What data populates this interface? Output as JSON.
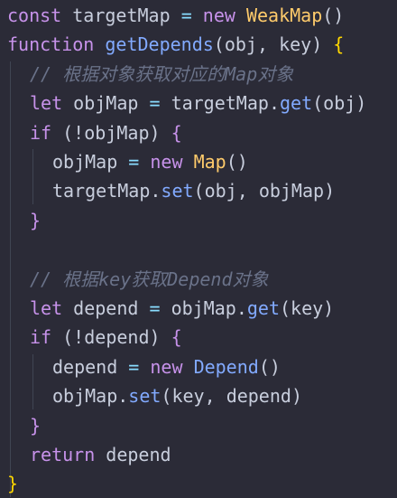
{
  "theme": {
    "background": "#2b2b37",
    "keyword": "#c792ea",
    "function": "#82aaff",
    "variable": "#c8cedd",
    "operator": "#89ddff",
    "class": "#ffcb6b",
    "comment": "#6a7289",
    "punctuation": "#c8cedd",
    "brace": "#ffd700",
    "indent_guide": "#404553"
  },
  "code": {
    "lines": [
      {
        "indent": 0,
        "tokens": [
          {
            "t": "const",
            "k": "keyword"
          },
          {
            "t": " "
          },
          {
            "t": "targetMap",
            "k": "variable"
          },
          {
            "t": " "
          },
          {
            "t": "=",
            "k": "operator"
          },
          {
            "t": " "
          },
          {
            "t": "new",
            "k": "keyword"
          },
          {
            "t": " "
          },
          {
            "t": "WeakMap",
            "k": "class"
          },
          {
            "t": "()",
            "k": "punctuation"
          }
        ]
      },
      {
        "indent": 0,
        "tokens": [
          {
            "t": "function",
            "k": "keyword"
          },
          {
            "t": " "
          },
          {
            "t": "getDepends",
            "k": "function"
          },
          {
            "t": "(",
            "k": "punctuation"
          },
          {
            "t": "obj",
            "k": "variable"
          },
          {
            "t": ", ",
            "k": "punctuation"
          },
          {
            "t": "key",
            "k": "variable"
          },
          {
            "t": ") ",
            "k": "punctuation"
          },
          {
            "t": "{",
            "k": "brace"
          }
        ]
      },
      {
        "indent": 1,
        "tokens": [
          {
            "t": "// 根据对象获取对应的Map对象",
            "k": "comment"
          }
        ]
      },
      {
        "indent": 1,
        "tokens": [
          {
            "t": "let",
            "k": "keyword"
          },
          {
            "t": " "
          },
          {
            "t": "objMap",
            "k": "variable"
          },
          {
            "t": " "
          },
          {
            "t": "=",
            "k": "operator"
          },
          {
            "t": " "
          },
          {
            "t": "targetMap",
            "k": "variable"
          },
          {
            "t": ".",
            "k": "punctuation"
          },
          {
            "t": "get",
            "k": "function"
          },
          {
            "t": "(",
            "k": "punctuation"
          },
          {
            "t": "obj",
            "k": "variable"
          },
          {
            "t": ")",
            "k": "punctuation"
          }
        ]
      },
      {
        "indent": 1,
        "tokens": [
          {
            "t": "if",
            "k": "keyword"
          },
          {
            "t": " "
          },
          {
            "t": "(!",
            "k": "punctuation"
          },
          {
            "t": "objMap",
            "k": "variable"
          },
          {
            "t": ") ",
            "k": "punctuation"
          },
          {
            "t": "{",
            "k": "keyword"
          }
        ]
      },
      {
        "indent": 2,
        "tokens": [
          {
            "t": "objMap",
            "k": "variable"
          },
          {
            "t": " "
          },
          {
            "t": "=",
            "k": "operator"
          },
          {
            "t": " "
          },
          {
            "t": "new",
            "k": "keyword"
          },
          {
            "t": " "
          },
          {
            "t": "Map",
            "k": "class"
          },
          {
            "t": "()",
            "k": "punctuation"
          }
        ]
      },
      {
        "indent": 2,
        "tokens": [
          {
            "t": "targetMap",
            "k": "variable"
          },
          {
            "t": ".",
            "k": "punctuation"
          },
          {
            "t": "set",
            "k": "function"
          },
          {
            "t": "(",
            "k": "punctuation"
          },
          {
            "t": "obj",
            "k": "variable"
          },
          {
            "t": ", ",
            "k": "punctuation"
          },
          {
            "t": "objMap",
            "k": "variable"
          },
          {
            "t": ")",
            "k": "punctuation"
          }
        ]
      },
      {
        "indent": 1,
        "tokens": [
          {
            "t": "}",
            "k": "keyword"
          }
        ]
      },
      {
        "indent": 0,
        "tokens": []
      },
      {
        "indent": 1,
        "tokens": [
          {
            "t": "// 根据key获取Depend对象",
            "k": "comment"
          }
        ]
      },
      {
        "indent": 1,
        "tokens": [
          {
            "t": "let",
            "k": "keyword"
          },
          {
            "t": " "
          },
          {
            "t": "depend",
            "k": "variable"
          },
          {
            "t": " "
          },
          {
            "t": "=",
            "k": "operator"
          },
          {
            "t": " "
          },
          {
            "t": "objMap",
            "k": "variable"
          },
          {
            "t": ".",
            "k": "punctuation"
          },
          {
            "t": "get",
            "k": "function"
          },
          {
            "t": "(",
            "k": "punctuation"
          },
          {
            "t": "key",
            "k": "variable"
          },
          {
            "t": ")",
            "k": "punctuation"
          }
        ]
      },
      {
        "indent": 1,
        "tokens": [
          {
            "t": "if",
            "k": "keyword"
          },
          {
            "t": " "
          },
          {
            "t": "(!",
            "k": "punctuation"
          },
          {
            "t": "depend",
            "k": "variable"
          },
          {
            "t": ") ",
            "k": "punctuation"
          },
          {
            "t": "{",
            "k": "keyword"
          }
        ]
      },
      {
        "indent": 2,
        "tokens": [
          {
            "t": "depend",
            "k": "variable"
          },
          {
            "t": " "
          },
          {
            "t": "=",
            "k": "operator"
          },
          {
            "t": " "
          },
          {
            "t": "new",
            "k": "keyword"
          },
          {
            "t": " "
          },
          {
            "t": "Depend",
            "k": "function"
          },
          {
            "t": "()",
            "k": "punctuation"
          }
        ]
      },
      {
        "indent": 2,
        "tokens": [
          {
            "t": "objMap",
            "k": "variable"
          },
          {
            "t": ".",
            "k": "punctuation"
          },
          {
            "t": "set",
            "k": "function"
          },
          {
            "t": "(",
            "k": "punctuation"
          },
          {
            "t": "key",
            "k": "variable"
          },
          {
            "t": ", ",
            "k": "punctuation"
          },
          {
            "t": "depend",
            "k": "variable"
          },
          {
            "t": ")",
            "k": "punctuation"
          }
        ]
      },
      {
        "indent": 1,
        "tokens": [
          {
            "t": "}",
            "k": "keyword"
          }
        ]
      },
      {
        "indent": 1,
        "tokens": [
          {
            "t": "return",
            "k": "keyword"
          },
          {
            "t": " "
          },
          {
            "t": "depend",
            "k": "variable"
          }
        ]
      },
      {
        "indent": 0,
        "tokens": [
          {
            "t": "}",
            "k": "brace"
          }
        ]
      }
    ]
  }
}
